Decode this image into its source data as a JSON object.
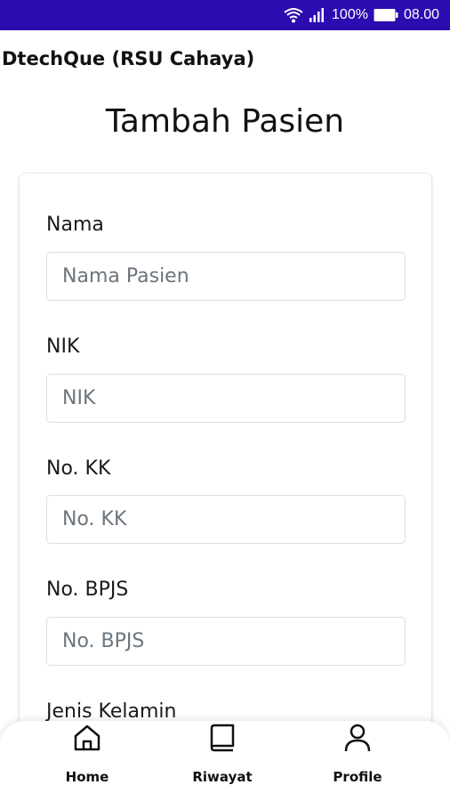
{
  "status_bar": {
    "battery_percent": "100%",
    "time": "08.00",
    "icons": [
      "wifi-icon",
      "signal-icon",
      "battery-icon"
    ]
  },
  "app": {
    "title": "DtechQue (RSU Cahaya)"
  },
  "page": {
    "title": "Tambah Pasien"
  },
  "form": {
    "fields": [
      {
        "label": "Nama",
        "placeholder": "Nama Pasien",
        "value": ""
      },
      {
        "label": "NIK",
        "placeholder": "NIK",
        "value": ""
      },
      {
        "label": "No. KK",
        "placeholder": "No. KK",
        "value": ""
      },
      {
        "label": "No. BPJS",
        "placeholder": "No. BPJS",
        "value": ""
      }
    ],
    "gender_label": "Jenis Kelamin"
  },
  "bottom_nav": {
    "items": [
      {
        "label": "Home",
        "icon": "home-icon"
      },
      {
        "label": "Riwayat",
        "icon": "book-icon"
      },
      {
        "label": "Profile",
        "icon": "person-icon"
      }
    ]
  },
  "colors": {
    "status_bar": "#2c0bb0",
    "input_border": "#d9dce1",
    "placeholder": "#6c757d"
  }
}
